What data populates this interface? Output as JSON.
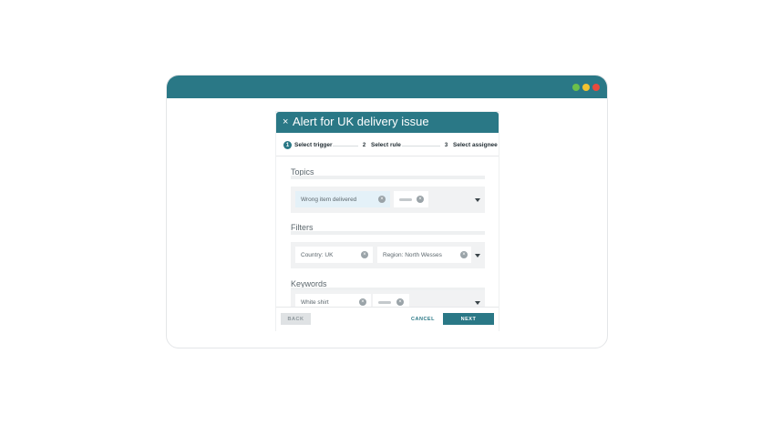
{
  "window": {
    "traffic_lights": [
      {
        "name": "green",
        "color": "#6cc04a"
      },
      {
        "name": "yellow",
        "color": "#f2c230"
      },
      {
        "name": "red",
        "color": "#e84a3c"
      }
    ]
  },
  "modal": {
    "title": "Alert for UK delivery issue",
    "close_icon": "×",
    "steps": [
      {
        "number": "1",
        "label": "Select trigger",
        "active": true
      },
      {
        "number": "2",
        "label": "Select rule",
        "active": false
      },
      {
        "number": "3",
        "label": "Select assignee",
        "active": false
      }
    ],
    "sections": {
      "topics": {
        "label": "Topics",
        "chips": [
          "Wrong item delivered"
        ]
      },
      "filters": {
        "label": "Filters",
        "chips": [
          "Country: UK",
          "Region: North Wesses"
        ]
      },
      "keywords": {
        "label": "Keywords",
        "chips": [
          "White shirt"
        ]
      }
    },
    "footer": {
      "back_label": "BACK",
      "cancel_label": "CANCEL",
      "next_label": "NEXT"
    }
  },
  "colors": {
    "primary": "#2a7886",
    "chip_highlight": "#e4f1f8",
    "field_bg": "#f1f2f3"
  }
}
